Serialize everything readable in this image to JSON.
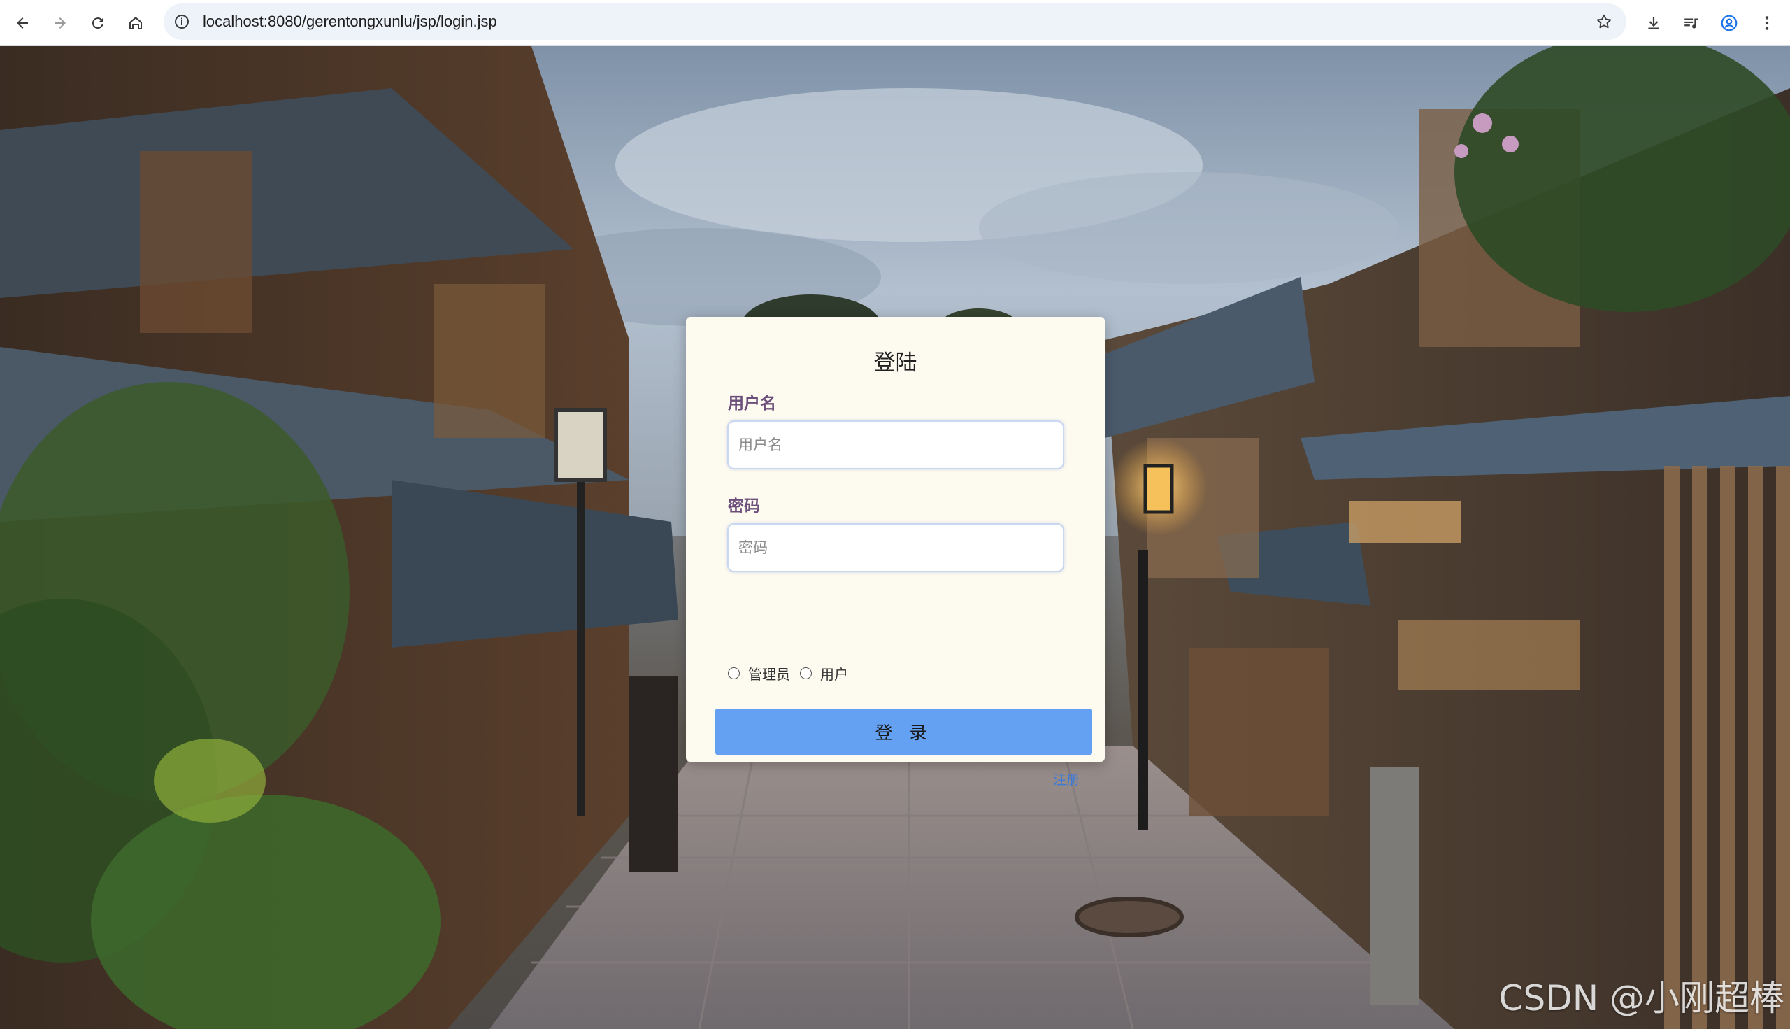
{
  "browser": {
    "url": "localhost:8080/gerentongxunlu/jsp/login.jsp"
  },
  "login": {
    "title": "登陆",
    "username_label": "用户名",
    "username_placeholder": "用户名",
    "password_label": "密码",
    "password_placeholder": "密码",
    "role_options": [
      "管理员",
      "用户"
    ],
    "submit_label": "登 录",
    "register_label": "注册"
  },
  "watermark": "CSDN @小刚超棒",
  "colors": {
    "card_background": "#fdfaef",
    "label_color": "#6b4f7a",
    "button_color": "#64a1f2",
    "link_color": "#3b7ad9"
  }
}
